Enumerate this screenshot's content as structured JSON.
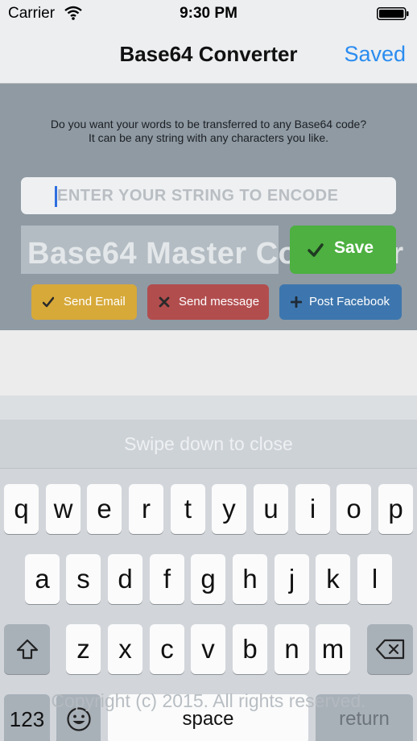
{
  "status_bar": {
    "carrier": "Carrier",
    "time": "9:30 PM"
  },
  "nav": {
    "title": "Base64 Converter",
    "saved_label": "Saved"
  },
  "main": {
    "prompt_line1": "Do you want your words to be transferred to any Base64 code?",
    "prompt_line2": "It can be any string with any characters you like.",
    "input_value": "",
    "input_placeholder": "ENTER YOUR STRING TO ENCODE",
    "banner_text": "Base64 Master Converter",
    "save_label": "Save",
    "send_email_label": "Send Email",
    "send_message_label": "Send message",
    "post_facebook_label": "Post Facebook"
  },
  "keyboard": {
    "swipe_hint": "Swipe down to close",
    "row1": [
      "q",
      "w",
      "e",
      "r",
      "t",
      "y",
      "u",
      "i",
      "o",
      "p"
    ],
    "row2": [
      "a",
      "s",
      "d",
      "f",
      "g",
      "h",
      "j",
      "k",
      "l"
    ],
    "row3": [
      "z",
      "x",
      "c",
      "v",
      "b",
      "n",
      "m"
    ],
    "numbers_label": "123",
    "space_label": "space",
    "return_label": "return"
  },
  "footer": {
    "copyright": "Copyright (c) 2015. All rights reserved."
  },
  "colors": {
    "accent": "#2a8cf0",
    "save_green": "#4db040",
    "email_yellow": "#d7a939",
    "message_red": "#b24d4e",
    "facebook_blue": "#3d76ae"
  },
  "icons": {
    "status": [
      "wifi-icon",
      "battery-icon"
    ],
    "buttons": [
      "checkmark-icon",
      "times-icon",
      "plus-icon"
    ],
    "keyboard": [
      "shift-icon",
      "backspace-icon",
      "emoji-icon"
    ]
  }
}
